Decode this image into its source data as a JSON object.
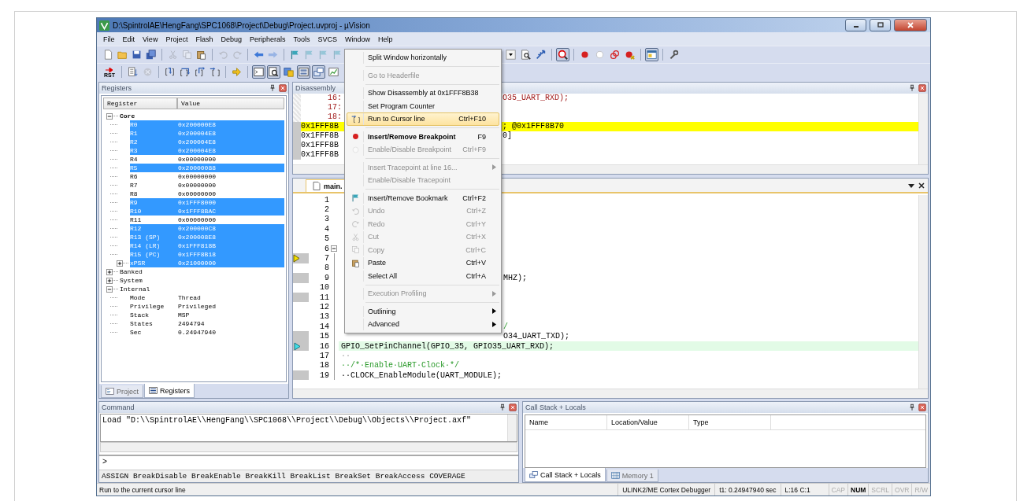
{
  "window": {
    "title": "D:\\SpintrolAE\\HengFang\\SPC1068\\Project\\Debug\\Project.uvproj - µVision"
  },
  "menu_bar": [
    "File",
    "Edit",
    "View",
    "Project",
    "Flash",
    "Debug",
    "Peripherals",
    "Tools",
    "SVCS",
    "Window",
    "Help"
  ],
  "toolbar_1_left": [
    {
      "kind": "button",
      "pressed": false,
      "disabled": false
    },
    {
      "kind": "button",
      "pressed": false,
      "disabled": false
    },
    {
      "kind": "button",
      "pressed": false,
      "disabled": false
    },
    {
      "kind": "button",
      "pressed": false,
      "disabled": false
    },
    {
      "kind": "separator"
    },
    {
      "kind": "button",
      "pressed": false,
      "disabled": true
    },
    {
      "kind": "button",
      "pressed": false,
      "disabled": true
    },
    {
      "kind": "button",
      "pressed": false,
      "disabled": false
    },
    {
      "kind": "separator"
    },
    {
      "kind": "button",
      "pressed": false,
      "disabled": true
    },
    {
      "kind": "button",
      "pressed": false,
      "disabled": true
    },
    {
      "kind": "separator"
    },
    {
      "kind": "button",
      "pressed": false,
      "disabled": false
    },
    {
      "kind": "button",
      "pressed": false,
      "disabled": true
    },
    {
      "kind": "separator"
    },
    {
      "kind": "button",
      "pressed": false,
      "disabled": false
    },
    {
      "kind": "button",
      "pressed": false,
      "disabled": true
    },
    {
      "kind": "button",
      "pressed": false,
      "disabled": true
    },
    {
      "kind": "button",
      "pressed": false,
      "disabled": true
    }
  ],
  "toolbar_1_right": [
    {
      "kind": "button",
      "pressed": false,
      "disabled": false
    },
    {
      "kind": "button",
      "pressed": false,
      "disabled": false
    },
    {
      "kind": "button",
      "pressed": false,
      "disabled": false
    },
    {
      "kind": "separator"
    },
    {
      "kind": "button",
      "pressed": true,
      "disabled": false
    },
    {
      "kind": "separator"
    },
    {
      "kind": "button",
      "pressed": false,
      "disabled": false
    },
    {
      "kind": "button",
      "pressed": false,
      "disabled": false
    },
    {
      "kind": "button",
      "pressed": false,
      "disabled": false
    },
    {
      "kind": "button",
      "pressed": false,
      "disabled": false
    },
    {
      "kind": "separator"
    },
    {
      "kind": "button",
      "pressed": true,
      "disabled": false
    },
    {
      "kind": "separator"
    },
    {
      "kind": "button",
      "pressed": false,
      "disabled": false
    }
  ],
  "toolbar_2": [
    {
      "kind": "text_button",
      "label": "RST",
      "pressed": false,
      "disabled": false
    },
    {
      "kind": "separator"
    },
    {
      "kind": "button",
      "pressed": false,
      "disabled": false
    },
    {
      "kind": "button",
      "pressed": false,
      "disabled": true
    },
    {
      "kind": "separator"
    },
    {
      "kind": "button",
      "pressed": false,
      "disabled": false
    },
    {
      "kind": "button",
      "pressed": false,
      "disabled": false
    },
    {
      "kind": "button",
      "pressed": false,
      "disabled": false
    },
    {
      "kind": "button",
      "pressed": false,
      "disabled": false
    },
    {
      "kind": "separator"
    },
    {
      "kind": "button",
      "pressed": false,
      "disabled": false
    },
    {
      "kind": "separator"
    },
    {
      "kind": "button",
      "pressed": true,
      "disabled": false
    },
    {
      "kind": "button",
      "pressed": true,
      "disabled": false
    },
    {
      "kind": "button",
      "pressed": false,
      "disabled": false
    },
    {
      "kind": "button",
      "pressed": true,
      "disabled": false
    },
    {
      "kind": "button",
      "pressed": true,
      "disabled": false
    },
    {
      "kind": "button",
      "pressed": false,
      "disabled": false
    }
  ],
  "registers": {
    "title": "Registers",
    "columns": [
      "Register",
      "Value"
    ],
    "tree": [
      {
        "name": "Core",
        "bold": true,
        "expanded": true,
        "children": [
          {
            "name": "R0",
            "value": "0x200000E8",
            "changed": true
          },
          {
            "name": "R1",
            "value": "0x200004E8",
            "changed": true
          },
          {
            "name": "R2",
            "value": "0x200004E8",
            "changed": true
          },
          {
            "name": "R3",
            "value": "0x200004E8",
            "changed": true
          },
          {
            "name": "R4",
            "value": "0x00000000",
            "changed": false
          },
          {
            "name": "R5",
            "value": "0x20000088",
            "changed": true
          },
          {
            "name": "R6",
            "value": "0x00000000",
            "changed": false
          },
          {
            "name": "R7",
            "value": "0x00000000",
            "changed": false
          },
          {
            "name": "R8",
            "value": "0x00000000",
            "changed": false
          },
          {
            "name": "R9",
            "value": "0x1FFF8000",
            "changed": true
          },
          {
            "name": "R10",
            "value": "0x1FFF8BAC",
            "changed": true
          },
          {
            "name": "R11",
            "value": "0x00000000",
            "changed": false
          },
          {
            "name": "R12",
            "value": "0x200000C8",
            "changed": true
          },
          {
            "name": "R13 (SP)",
            "value": "0x200008E8",
            "changed": true
          },
          {
            "name": "R14 (LR)",
            "value": "0x1FFF818B",
            "changed": true
          },
          {
            "name": "R15 (PC)",
            "value": "0x1FFF8B18",
            "changed": true
          },
          {
            "name": "xPSR",
            "value": "0x21000000",
            "changed": true,
            "expanded": false
          }
        ]
      },
      {
        "name": "Banked",
        "bold": false,
        "expanded": false
      },
      {
        "name": "System",
        "bold": false,
        "expanded": false
      },
      {
        "name": "Internal",
        "bold": false,
        "expanded": true,
        "children": [
          {
            "name": "Mode",
            "value": "Thread",
            "changed": false
          },
          {
            "name": "Privilege",
            "value": "Privileged",
            "changed": false
          },
          {
            "name": "Stack",
            "value": "MSP",
            "changed": false
          },
          {
            "name": "States",
            "value": "2494794",
            "changed": false
          },
          {
            "name": "Sec",
            "value": "0.24947940",
            "changed": false
          }
        ]
      }
    ],
    "tabs": [
      {
        "label": "Project",
        "selected": false
      },
      {
        "label": "Registers",
        "selected": true
      }
    ]
  },
  "disassembly": {
    "title": "Disassembly",
    "lines": [
      {
        "kind": "source",
        "address": "16:",
        "highlighted": false,
        "text_right": "O35_UART_RXD);"
      },
      {
        "kind": "source",
        "address": "17:",
        "highlighted": false
      },
      {
        "kind": "source",
        "address": "18:",
        "highlighted": false
      },
      {
        "kind": "asm",
        "address": "0x1FFF8B",
        "highlighted": true,
        "text_right": "; @0x1FFF8B70"
      },
      {
        "kind": "asm",
        "address": "0x1FFF8B",
        "highlighted": false,
        "text_right": "0]"
      },
      {
        "kind": "asm",
        "address": "0x1FFF8B",
        "highlighted": false
      },
      {
        "kind": "asm",
        "address": "0x1FFF8B",
        "highlighted": false
      }
    ]
  },
  "editor": {
    "tabs": [
      {
        "label": "main.",
        "selected": true
      }
    ],
    "lines": [
      {
        "number": "1",
        "executable": false,
        "highlighted": false,
        "pc": false,
        "cursor": false
      },
      {
        "number": "2",
        "executable": false,
        "highlighted": false,
        "pc": false,
        "cursor": false
      },
      {
        "number": "3",
        "executable": false,
        "highlighted": false,
        "pc": false,
        "cursor": false
      },
      {
        "number": "4",
        "executable": false,
        "highlighted": false,
        "pc": false,
        "cursor": false
      },
      {
        "number": "5",
        "executable": false,
        "highlighted": false,
        "pc": false,
        "cursor": false
      },
      {
        "number": "6",
        "executable": false,
        "highlighted": false,
        "pc": false,
        "cursor": false,
        "fold_start": true
      },
      {
        "number": "7",
        "executable": true,
        "highlighted": false,
        "pc": true,
        "cursor": false
      },
      {
        "number": "8",
        "executable": false,
        "highlighted": false,
        "pc": false,
        "cursor": false
      },
      {
        "number": "9",
        "executable": true,
        "highlighted": false,
        "pc": false,
        "cursor": false,
        "text_right": "MHZ);",
        "kind": "code"
      },
      {
        "number": "10",
        "executable": false,
        "highlighted": false,
        "pc": false,
        "cursor": false
      },
      {
        "number": "11",
        "executable": true,
        "highlighted": false,
        "pc": false,
        "cursor": false
      },
      {
        "number": "12",
        "executable": false,
        "highlighted": false,
        "pc": false,
        "cursor": false
      },
      {
        "number": "13",
        "executable": false,
        "highlighted": false,
        "pc": false,
        "cursor": false
      },
      {
        "number": "14",
        "executable": false,
        "highlighted": false,
        "pc": false,
        "cursor": false,
        "text_right": "/",
        "kind": "comment"
      },
      {
        "number": "15",
        "executable": true,
        "highlighted": false,
        "pc": false,
        "cursor": false,
        "text_right": "O34_UART_TXD);",
        "kind": "code"
      },
      {
        "number": "16",
        "executable": true,
        "highlighted": true,
        "pc": false,
        "cursor": true,
        "text": "GPIO_SetPinChannel(GPIO_35, GPIO35_UART_RXD);",
        "kind": "code"
      },
      {
        "number": "17",
        "executable": false,
        "highlighted": false,
        "pc": false,
        "cursor": false,
        "text": "··",
        "kind": "whitespace"
      },
      {
        "number": "18",
        "executable": false,
        "highlighted": false,
        "pc": false,
        "cursor": false,
        "text": "··/*·Enable·UART·Clock·*/",
        "kind": "comment"
      },
      {
        "number": "19",
        "executable": true,
        "highlighted": false,
        "pc": false,
        "cursor": false,
        "text": "··CLOCK_EnableModule(UART_MODULE);",
        "kind": "code"
      }
    ]
  },
  "context_menu": {
    "items": [
      {
        "kind": "item",
        "label": "Split Window horizontally",
        "disabled": false,
        "highlighted": false,
        "default": false,
        "submenu": false
      },
      {
        "kind": "separator"
      },
      {
        "kind": "item",
        "label": "Go to Headerfile",
        "disabled": true,
        "highlighted": false,
        "default": false,
        "submenu": false
      },
      {
        "kind": "separator"
      },
      {
        "kind": "item",
        "label": "Show Disassembly at 0x1FFF8B38",
        "disabled": false,
        "highlighted": false,
        "default": false,
        "submenu": false
      },
      {
        "kind": "item",
        "label": "Set Program Counter",
        "disabled": false,
        "highlighted": false,
        "default": false,
        "submenu": false
      },
      {
        "kind": "item",
        "label": "Run to Cursor line",
        "shortcut": "Ctrl+F10",
        "disabled": false,
        "highlighted": true,
        "default": false,
        "submenu": false
      },
      {
        "kind": "separator"
      },
      {
        "kind": "item",
        "label": "Insert/Remove Breakpoint",
        "shortcut": "F9",
        "disabled": false,
        "highlighted": false,
        "default": true,
        "submenu": false
      },
      {
        "kind": "item",
        "label": "Enable/Disable Breakpoint",
        "shortcut": "Ctrl+F9",
        "disabled": true,
        "highlighted": false,
        "default": false,
        "submenu": false
      },
      {
        "kind": "separator"
      },
      {
        "kind": "item",
        "label": "Insert Tracepoint at line 16...",
        "disabled": true,
        "highlighted": false,
        "default": false,
        "submenu": true
      },
      {
        "kind": "item",
        "label": "Enable/Disable Tracepoint",
        "disabled": true,
        "highlighted": false,
        "default": false,
        "submenu": false
      },
      {
        "kind": "separator"
      },
      {
        "kind": "item",
        "label": "Insert/Remove Bookmark",
        "shortcut": "Ctrl+F2",
        "disabled": false,
        "highlighted": false,
        "default": false,
        "submenu": false
      },
      {
        "kind": "item",
        "label": "Undo",
        "shortcut": "Ctrl+Z",
        "disabled": true,
        "highlighted": false,
        "default": false,
        "submenu": false
      },
      {
        "kind": "item",
        "label": "Redo",
        "shortcut": "Ctrl+Y",
        "disabled": true,
        "highlighted": false,
        "default": false,
        "submenu": false
      },
      {
        "kind": "item",
        "label": "Cut",
        "shortcut": "Ctrl+X",
        "disabled": true,
        "highlighted": false,
        "default": false,
        "submenu": false
      },
      {
        "kind": "item",
        "label": "Copy",
        "shortcut": "Ctrl+C",
        "disabled": true,
        "highlighted": false,
        "default": false,
        "submenu": false
      },
      {
        "kind": "item",
        "label": "Paste",
        "shortcut": "Ctrl+V",
        "disabled": false,
        "highlighted": false,
        "default": false,
        "submenu": false
      },
      {
        "kind": "item",
        "label": "Select All",
        "shortcut": "Ctrl+A",
        "disabled": false,
        "highlighted": false,
        "default": false,
        "submenu": false
      },
      {
        "kind": "separator"
      },
      {
        "kind": "item",
        "label": "Execution Profiling",
        "disabled": true,
        "highlighted": false,
        "default": false,
        "submenu": true
      },
      {
        "kind": "separator"
      },
      {
        "kind": "item",
        "label": "Outlining",
        "disabled": false,
        "highlighted": false,
        "default": false,
        "submenu": true
      },
      {
        "kind": "item",
        "label": "Advanced",
        "disabled": false,
        "highlighted": false,
        "default": false,
        "submenu": true
      }
    ]
  },
  "command": {
    "title": "Command",
    "output": "Load \"D:\\\\SpintrolAE\\\\HengFang\\\\SPC1068\\\\Project\\\\Debug\\\\Objects\\\\Project.axf\"",
    "prompt": ">",
    "help": "ASSIGN BreakDisable BreakEnable BreakKill BreakList BreakSet BreakAccess COVERAGE"
  },
  "call_stack": {
    "title": "Call Stack + Locals",
    "columns": [
      "Name",
      "Location/Value",
      "Type"
    ],
    "tabs": [
      {
        "label": "Call Stack + Locals",
        "selected": true
      },
      {
        "label": "Memory 1",
        "selected": false
      }
    ]
  },
  "status_bar": {
    "message": "Run to the current cursor line",
    "debugger": "ULINK2/ME Cortex Debugger",
    "time": "t1: 0.24947940 sec",
    "position": "L:16 C:1",
    "indicators": [
      {
        "label": "CAP",
        "on": false
      },
      {
        "label": "NUM",
        "on": true
      },
      {
        "label": "SCRL",
        "on": false
      },
      {
        "label": "OVR",
        "on": false
      },
      {
        "label": "R/W",
        "on": false
      }
    ]
  }
}
